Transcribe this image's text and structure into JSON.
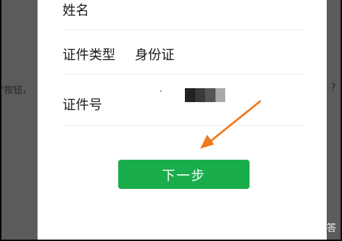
{
  "background_doc": {
    "text_fragment": "\"按钮，",
    "trailing_char": "?"
  },
  "form": {
    "name_label": "姓名",
    "id_type_label": "证件类型",
    "id_type_value": "身份证",
    "id_number_label": "证件号",
    "id_number_mask_colors": [
      "#222222",
      "#3a3a3a",
      "#555555",
      "#a8a8a8"
    ]
  },
  "next_button_label": "下一步",
  "watermark": {
    "text": "悟空问答",
    "icon": "wukong-logo-icon"
  },
  "colors": {
    "button_green": "#1aad4c",
    "arrow_orange": "#f07a1e",
    "backdrop": "#5b5b5b"
  }
}
